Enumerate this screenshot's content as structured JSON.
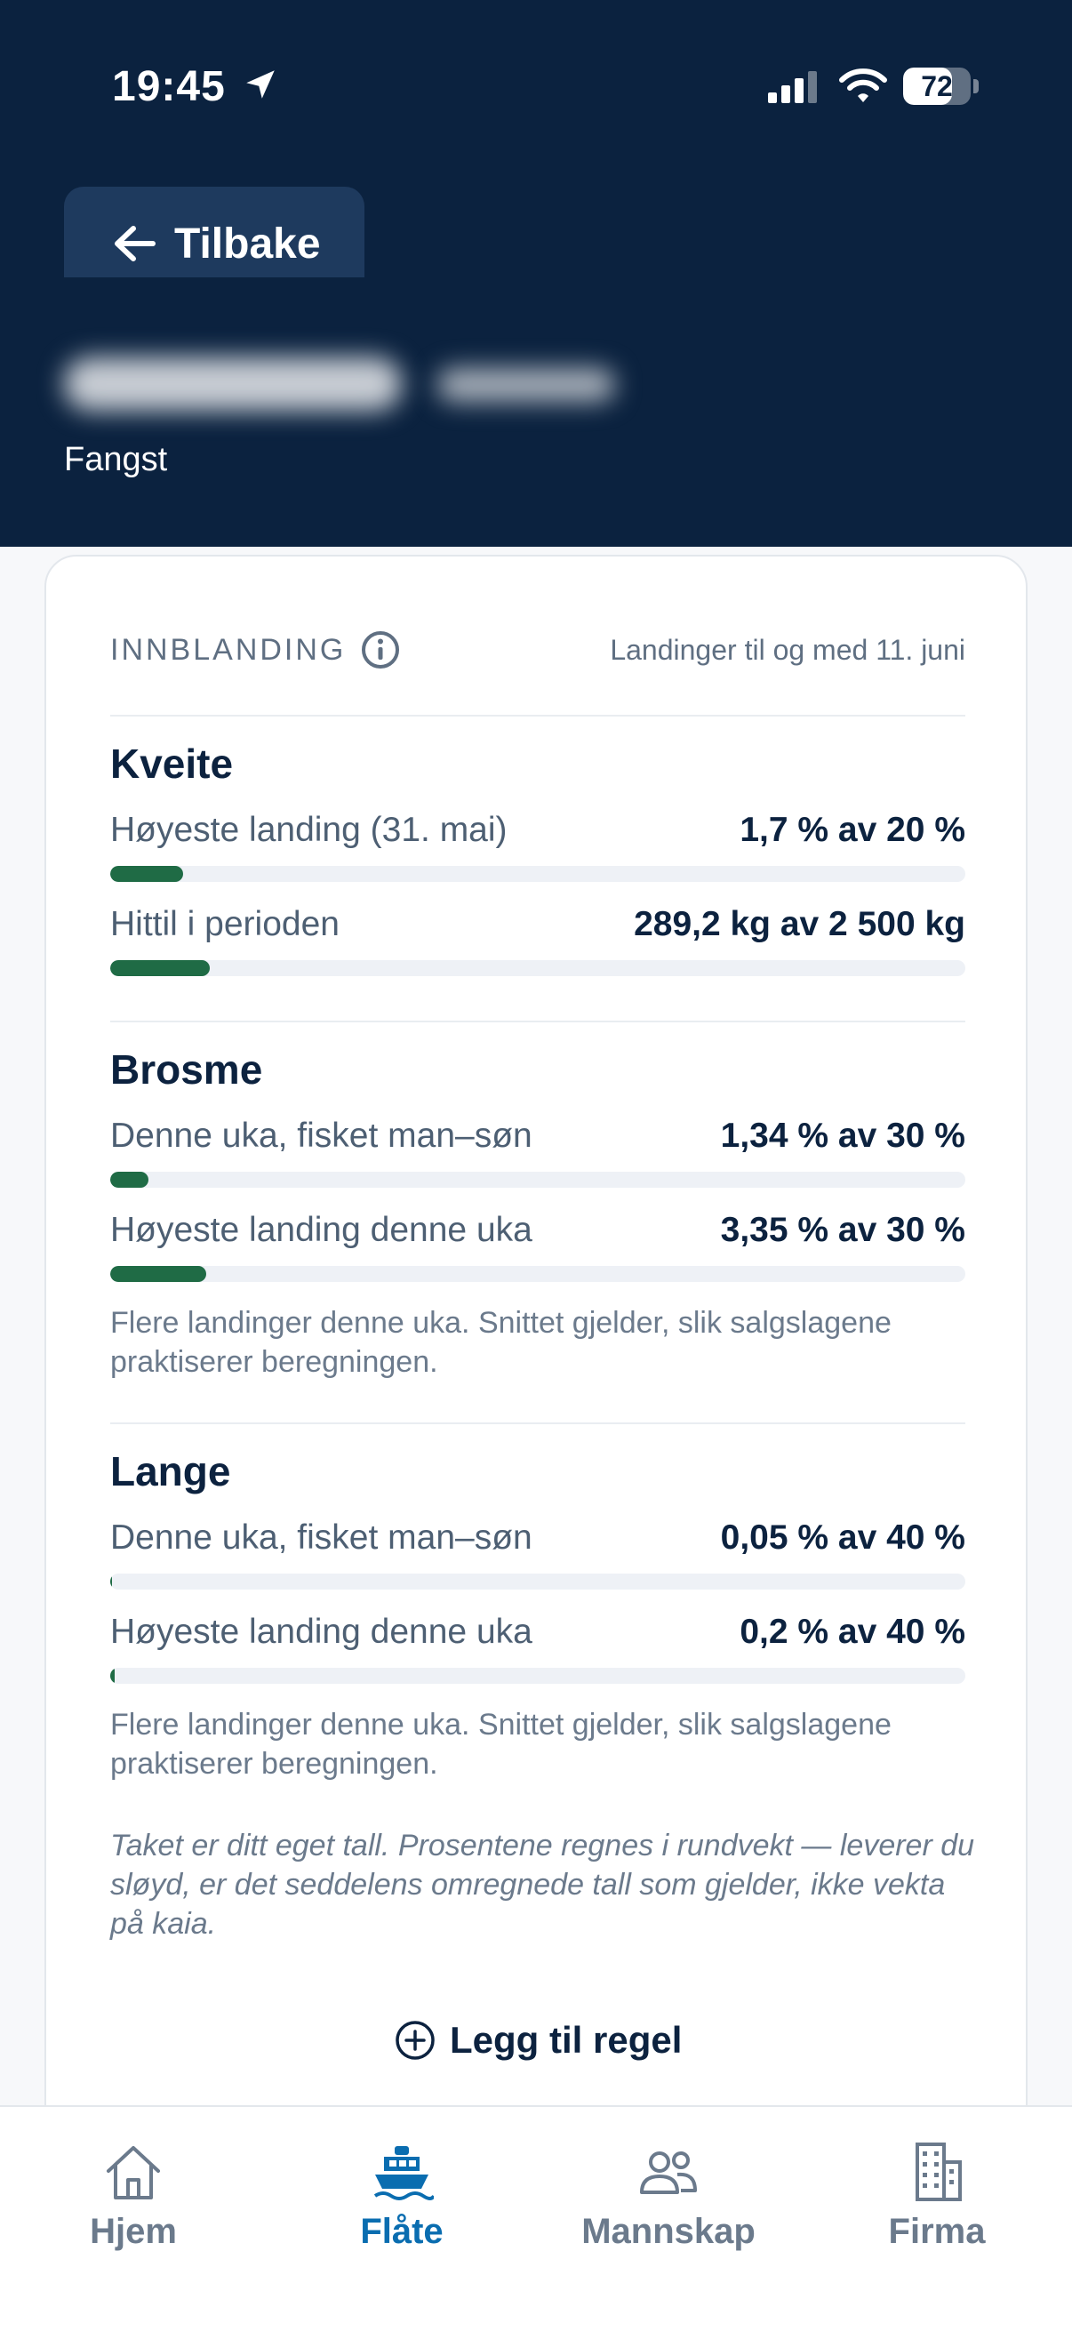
{
  "status_bar": {
    "time": "19:45",
    "battery": "72",
    "battery_level": 0.72
  },
  "header": {
    "back_label": "Tilbake",
    "subtitle": "Fangst"
  },
  "card": {
    "section_label": "INNBLANDING",
    "date_note": "Landinger til og med 11. juni",
    "groups": [
      {
        "species": "Kveite",
        "rows": [
          {
            "label": "Høyeste landing (31. mai)",
            "value": "1,7 % av 20 %",
            "fraction": 0.085
          },
          {
            "label": "Hittil i perioden",
            "value": "289,2 kg av 2 500 kg",
            "fraction": 0.116
          }
        ]
      },
      {
        "species": "Brosme",
        "rows": [
          {
            "label": "Denne uka, fisket man–søn",
            "value": "1,34 % av 30 %",
            "fraction": 0.045
          },
          {
            "label": "Høyeste landing denne uka",
            "value": "3,35 % av 30 %",
            "fraction": 0.112
          }
        ],
        "note": "Flere landinger denne uka. Snittet gjelder, slik salgslagene praktiserer beregningen."
      },
      {
        "species": "Lange",
        "rows": [
          {
            "label": "Denne uka, fisket man–søn",
            "value": "0,05 % av 40 %",
            "fraction": 0.00125
          },
          {
            "label": "Høyeste landing denne uka",
            "value": "0,2 % av 40 %",
            "fraction": 0.005
          }
        ],
        "note": "Flere landinger denne uka. Snittet gjelder, slik salgslagene praktiserer beregningen."
      }
    ],
    "footnote": "Taket er ditt eget tall. Prosentene regnes i rundvekt — leverer du sløyd, er det seddelens omregnede tall som gjelder, ikke vekta på kaia.",
    "add_rule_label": "Legg til regel"
  },
  "tabbar": {
    "tabs": [
      {
        "label": "Hjem",
        "icon": "home-icon",
        "active": false
      },
      {
        "label": "Flåte",
        "icon": "boat-icon",
        "active": true
      },
      {
        "label": "Mannskap",
        "icon": "people-icon",
        "active": false
      },
      {
        "label": "Firma",
        "icon": "building-icon",
        "active": false
      }
    ]
  },
  "colors": {
    "header_bg": "#0b223f",
    "accent": "#0a6db0",
    "bar_fill": "#1f6b45",
    "bar_track": "#eef1f6"
  }
}
